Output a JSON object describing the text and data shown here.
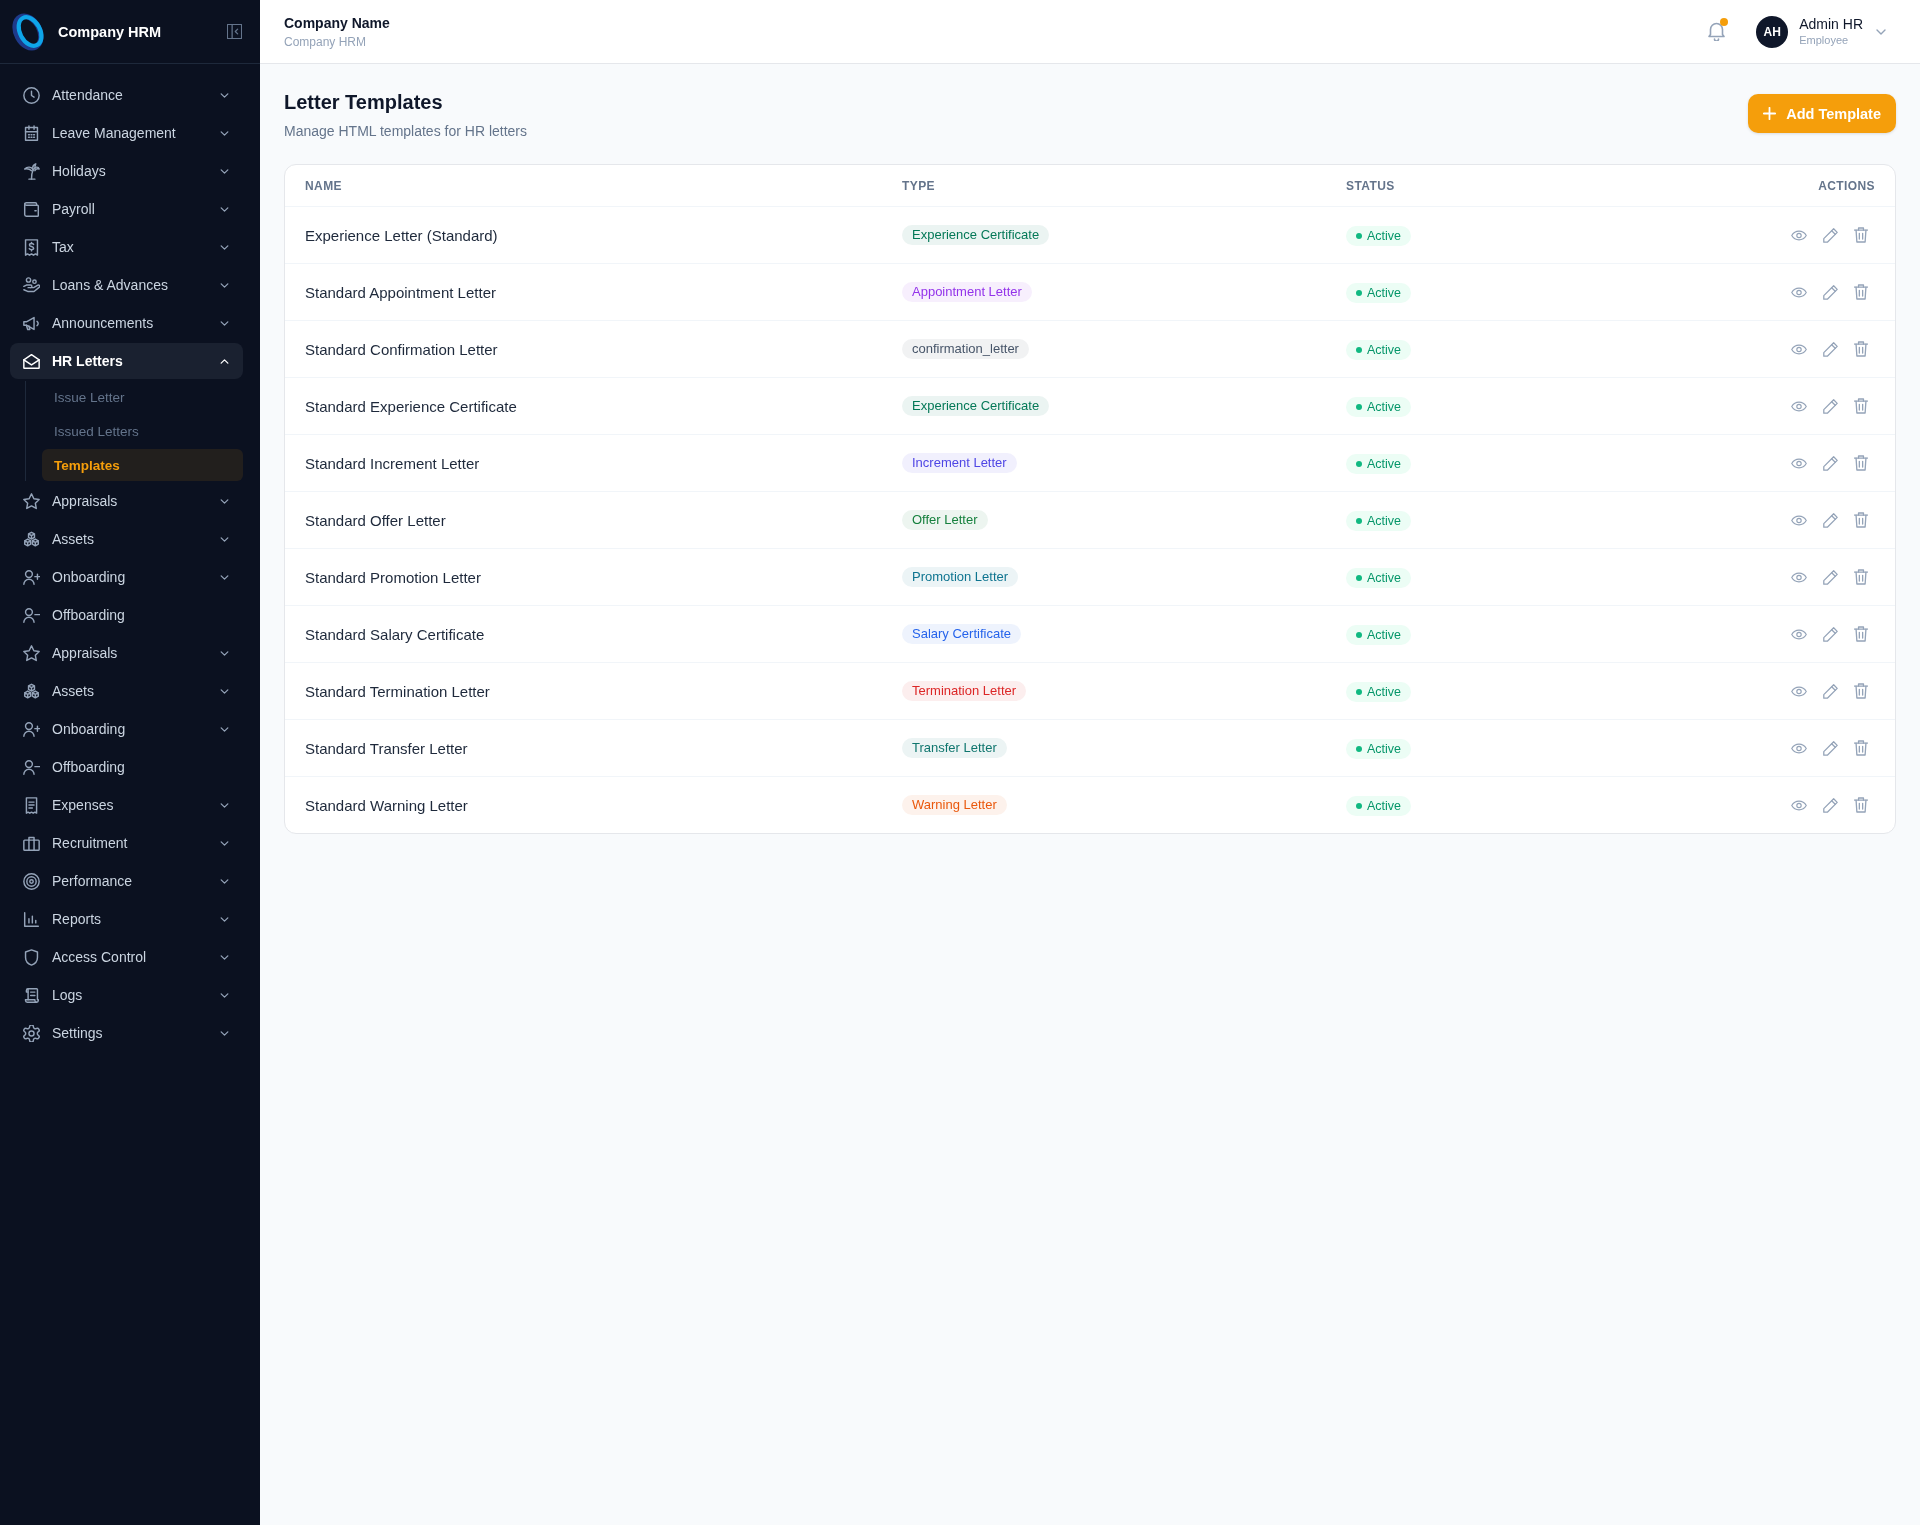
{
  "sidebar": {
    "brand": "Company HRM",
    "items": [
      {
        "label": "Attendance",
        "kind": "group",
        "expanded": false,
        "selected": false
      },
      {
        "label": "Leave Management",
        "kind": "group",
        "expanded": false,
        "selected": false
      },
      {
        "label": "Holidays",
        "kind": "group",
        "expanded": false,
        "selected": false
      },
      {
        "label": "Payroll",
        "kind": "group",
        "expanded": false,
        "selected": false
      },
      {
        "label": "Tax",
        "kind": "group",
        "expanded": false,
        "selected": false
      },
      {
        "label": "Loans & Advances",
        "kind": "group",
        "expanded": false,
        "selected": false
      },
      {
        "label": "Announcements",
        "kind": "group",
        "expanded": false,
        "selected": false
      },
      {
        "label": "HR Letters",
        "kind": "group",
        "expanded": true,
        "selected": true,
        "children": [
          {
            "label": "Issue Letter",
            "selected": false
          },
          {
            "label": "Issued Letters",
            "selected": false
          },
          {
            "label": "Templates",
            "selected": true
          }
        ]
      },
      {
        "label": "Appraisals",
        "kind": "group",
        "expanded": false,
        "selected": false
      },
      {
        "label": "Assets",
        "kind": "group",
        "expanded": false,
        "selected": false
      },
      {
        "label": "Onboarding",
        "kind": "group",
        "expanded": false,
        "selected": false
      },
      {
        "label": "Offboarding",
        "kind": "link",
        "selected": false
      },
      {
        "label": "Appraisals",
        "kind": "group",
        "expanded": false,
        "selected": false
      },
      {
        "label": "Assets",
        "kind": "group",
        "expanded": false,
        "selected": false
      },
      {
        "label": "Onboarding",
        "kind": "group",
        "expanded": false,
        "selected": false
      },
      {
        "label": "Offboarding",
        "kind": "link",
        "selected": false
      },
      {
        "label": "Expenses",
        "kind": "group",
        "expanded": false,
        "selected": false
      },
      {
        "label": "Recruitment",
        "kind": "group",
        "expanded": false,
        "selected": false
      },
      {
        "label": "Performance",
        "kind": "group",
        "expanded": false,
        "selected": false
      },
      {
        "label": "Reports",
        "kind": "group",
        "expanded": false,
        "selected": false
      },
      {
        "label": "Access Control",
        "kind": "group",
        "expanded": false,
        "selected": false
      },
      {
        "label": "Logs",
        "kind": "group",
        "expanded": false,
        "selected": false
      },
      {
        "label": "Settings",
        "kind": "group",
        "expanded": false,
        "selected": false
      }
    ]
  },
  "header": {
    "company": "Company Name",
    "subtitle": "Company HRM",
    "notifications": {
      "unread": true
    },
    "user": {
      "initials": "AH",
      "name": "Admin HR",
      "role": "Employee"
    }
  },
  "page": {
    "title": "Letter Templates",
    "subtitle": "Manage HTML templates for HR letters",
    "add_button": "Add Template"
  },
  "table": {
    "columns": [
      "NAME",
      "TYPE",
      "STATUS",
      "ACTIONS"
    ],
    "rows": [
      {
        "name": "Experience Letter (Standard)",
        "type": {
          "label": "Experience Certificate",
          "color": "#047857"
        },
        "status": "Active",
        "active": true
      },
      {
        "name": "Standard Appointment Letter",
        "type": {
          "label": "Appointment Letter",
          "color": "#9333ea"
        },
        "status": "Active",
        "active": true
      },
      {
        "name": "Standard Confirmation Letter",
        "type": {
          "label": "confirmation_letter",
          "color": "#475569"
        },
        "status": "Active",
        "active": true
      },
      {
        "name": "Standard Experience Certificate",
        "type": {
          "label": "Experience Certificate",
          "color": "#047857"
        },
        "status": "Active",
        "active": true
      },
      {
        "name": "Standard Increment Letter",
        "type": {
          "label": "Increment Letter",
          "color": "#4f46e5"
        },
        "status": "Active",
        "active": true
      },
      {
        "name": "Standard Offer Letter",
        "type": {
          "label": "Offer Letter",
          "color": "#15803d"
        },
        "status": "Active",
        "active": true
      },
      {
        "name": "Standard Promotion Letter",
        "type": {
          "label": "Promotion Letter",
          "color": "#0e7490"
        },
        "status": "Active",
        "active": true
      },
      {
        "name": "Standard Salary Certificate",
        "type": {
          "label": "Salary Certificate",
          "color": "#2563eb"
        },
        "status": "Active",
        "active": true
      },
      {
        "name": "Standard Termination Letter",
        "type": {
          "label": "Termination Letter",
          "color": "#dc2626"
        },
        "status": "Active",
        "active": true
      },
      {
        "name": "Standard Transfer Letter",
        "type": {
          "label": "Transfer Letter",
          "color": "#0f766e"
        },
        "status": "Active",
        "active": true
      },
      {
        "name": "Standard Warning Letter",
        "type": {
          "label": "Warning Letter",
          "color": "#ea580c"
        },
        "status": "Active",
        "active": true
      }
    ]
  }
}
